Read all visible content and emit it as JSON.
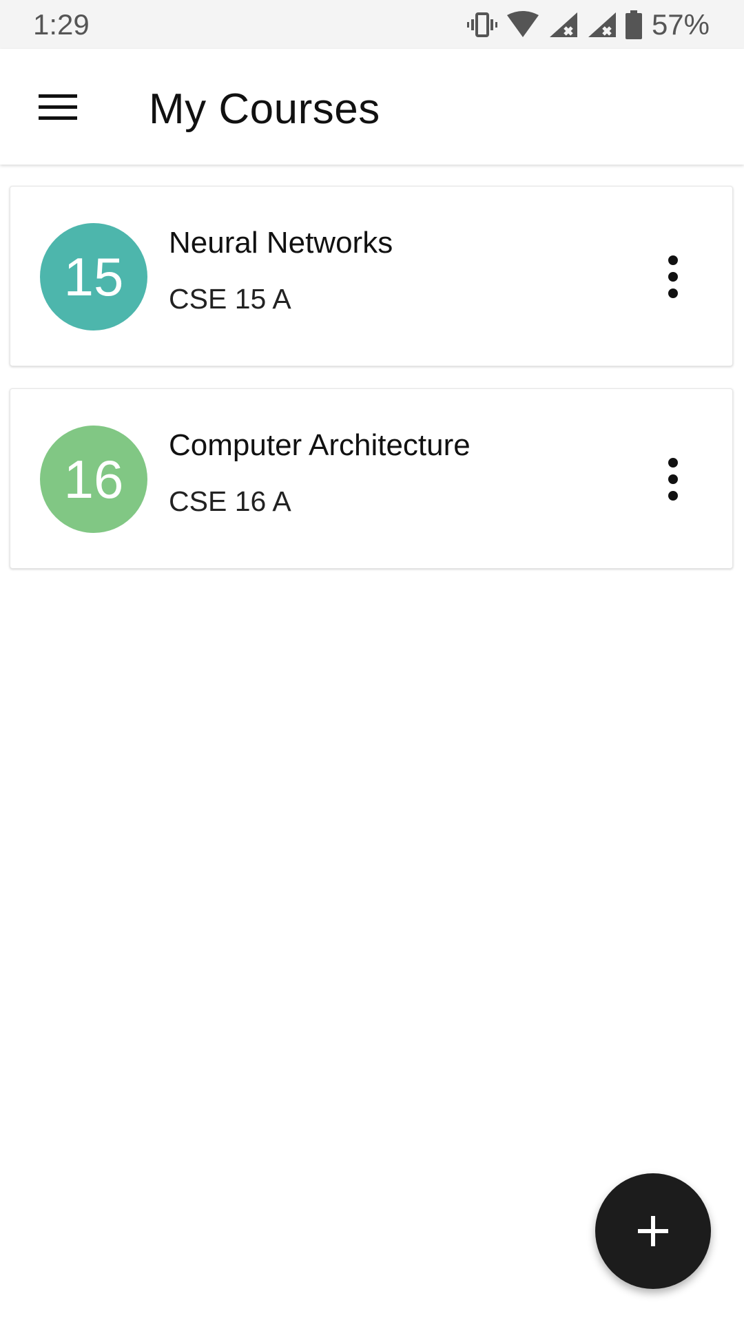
{
  "status_bar": {
    "time": "1:29",
    "battery_percent": "57%",
    "icons": [
      "vibrate-icon",
      "wifi-icon",
      "signal-no-data-icon",
      "signal-no-data-icon",
      "battery-icon"
    ]
  },
  "app_bar": {
    "title": "My Courses",
    "menu_icon": "hamburger-menu-icon"
  },
  "courses": [
    {
      "number": "15",
      "name": "Neural Networks",
      "code": "CSE 15 A",
      "avatar_color": "#4db6ac",
      "menu_icon": "more-vert-icon"
    },
    {
      "number": "16",
      "name": "Computer Architecture",
      "code": "CSE 16 A",
      "avatar_color": "#81c784",
      "menu_icon": "more-vert-icon"
    }
  ],
  "fab": {
    "icon": "plus-icon",
    "color": "#1c1c1c"
  }
}
